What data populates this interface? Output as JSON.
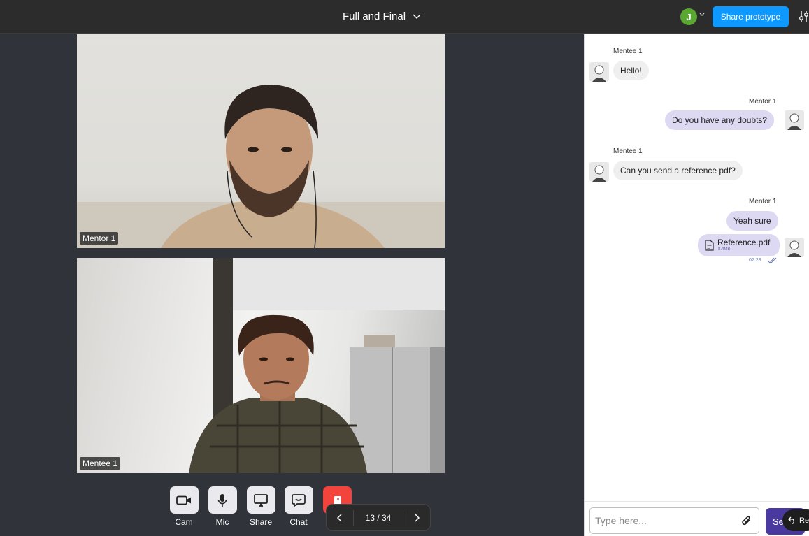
{
  "header": {
    "title": "Full and Final",
    "user_initial": "J",
    "share_label": "Share prototype"
  },
  "videos": [
    {
      "label": "Mentor 1"
    },
    {
      "label": "Mentee 1"
    }
  ],
  "controls": {
    "cam": "Cam",
    "mic": "Mic",
    "share": "Share",
    "chat": "Chat"
  },
  "pager": {
    "text": "13 / 34"
  },
  "chat": {
    "messages": [
      {
        "sender": "Mentee 1",
        "text": "Hello!"
      },
      {
        "sender": "Mentor 1",
        "text": "Do you have any doubts?"
      },
      {
        "sender": "Mentee 1",
        "text": "Can you send a reference pdf?"
      },
      {
        "sender": "Mentor 1",
        "text": "Yeah sure"
      }
    ],
    "file": {
      "name": "Reference.pdf",
      "size": "8.4MB",
      "time": "02:23"
    },
    "input_placeholder": "Type here...",
    "send_label": "Se",
    "restore_label": "Re"
  },
  "colors": {
    "accent": "#0d99ff",
    "send": "#4a3aa0",
    "end_call": "#f2443d",
    "outgoing_bubble": "#ddd9f2"
  }
}
